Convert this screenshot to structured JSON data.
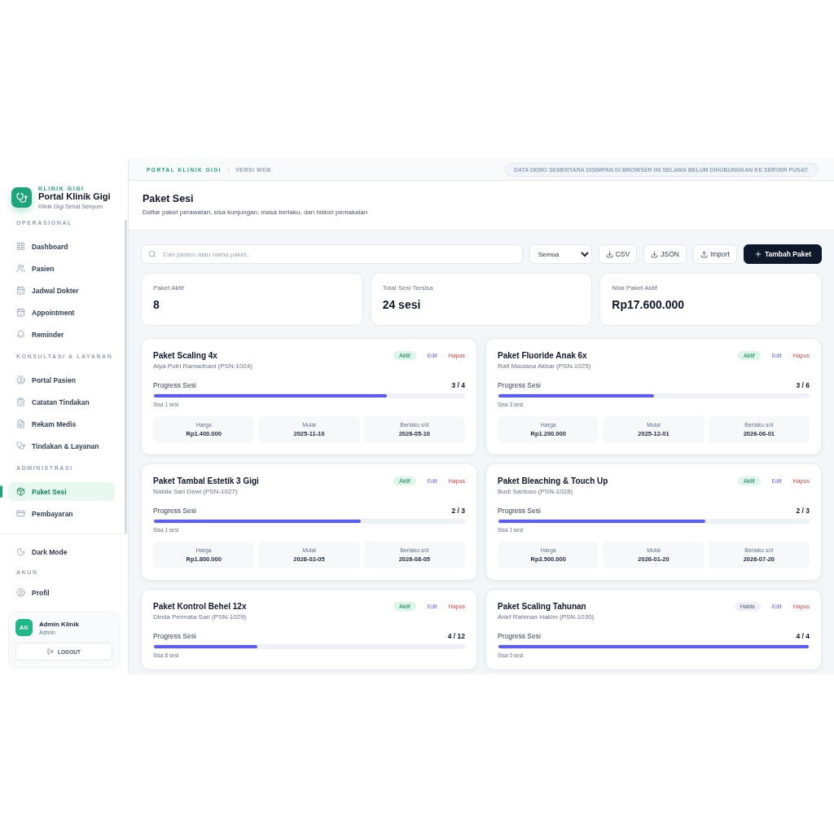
{
  "brand": {
    "eyebrow": "KLINIK GIGI",
    "title": "Portal Klinik Gigi",
    "subtitle": "Klinik Gigi Sehat Senyum"
  },
  "sidebar": {
    "sections": [
      {
        "title": "OPERASIONAL",
        "items": [
          {
            "label": "Dashboard",
            "selected": false
          },
          {
            "label": "Pasien",
            "selected": false
          },
          {
            "label": "Jadwal Dokter",
            "selected": false
          },
          {
            "label": "Appointment",
            "selected": false
          },
          {
            "label": "Reminder",
            "selected": false
          }
        ]
      },
      {
        "title": "KONSULTASI & LAYANAN",
        "items": [
          {
            "label": "Portal Pasien",
            "selected": false
          },
          {
            "label": "Catatan Tindakan",
            "selected": false
          },
          {
            "label": "Rekam Medis",
            "selected": false
          },
          {
            "label": "Tindakan & Layanan",
            "selected": false
          }
        ]
      },
      {
        "title": "ADMINISTRASI",
        "items": [
          {
            "label": "Paket Sesi",
            "selected": true
          },
          {
            "label": "Pembayaran",
            "selected": false
          }
        ]
      }
    ],
    "dark_mode": "Dark Mode",
    "account_title": "AKUN",
    "account_items": [
      {
        "label": "Profil",
        "selected": false
      }
    ],
    "user": {
      "initials": "AK",
      "name": "Admin Klinik",
      "role": "Admin",
      "logout": "LOGOUT"
    }
  },
  "topbar": {
    "brand": "PORTAL KLINIK GIGI",
    "version": "VERSI WEB",
    "notice": "DATA DEMO SEMENTARA DISIMPAN DI BROWSER INI SELAMA BELUM DIHUBUNGKAN KE SERVER PUSAT."
  },
  "header": {
    "title": "Paket Sesi",
    "subtitle": "Daftar paket perawatan, sisa kunjungan, masa berlaku, dan histori pemakaian"
  },
  "toolbar": {
    "search_placeholder": "Cari pasien atau nama paket...",
    "filter": "Semua",
    "buttons": [
      "CSV",
      "JSON",
      "Import"
    ],
    "primary": "Tambah Paket"
  },
  "stats": [
    {
      "label": "Paket Aktif",
      "value": "8"
    },
    {
      "label": "Total Sesi Tersisa",
      "value": "24 sesi"
    },
    {
      "label": "Nilai Paket Aktif",
      "value": "Rp17.600.000"
    }
  ],
  "packages": [
    {
      "name": "Paket Scaling 4x",
      "patient": "Alya Putri Ramadhani (PSN-1024)",
      "status": {
        "label": "Aktif",
        "kind": "active"
      },
      "edit": "Edit",
      "delete": "Hapus",
      "progress_label": "Progress Sesi",
      "count": "3 / 4",
      "level": 0.75,
      "remaining": "Sisa 1 sesi",
      "details": [
        {
          "label": "Harga",
          "value": "Rp1.400.000"
        },
        {
          "label": "Mulai",
          "value": "2025-11-10"
        },
        {
          "label": "Berlaku s/d",
          "value": "2026-05-10"
        }
      ]
    },
    {
      "name": "Paket Fluoride Anak 6x",
      "patient": "Rafi Maulana Akbar (PSN-1025)",
      "status": {
        "label": "Aktif",
        "kind": "active"
      },
      "edit": "Edit",
      "delete": "Hapus",
      "progress_label": "Progress Sesi",
      "count": "3 / 6",
      "level": 0.5,
      "remaining": "Sisa 3 sesi",
      "details": [
        {
          "label": "Harga",
          "value": "Rp1.200.000"
        },
        {
          "label": "Mulai",
          "value": "2025-12-01"
        },
        {
          "label": "Berlaku s/d",
          "value": "2026-06-01"
        }
      ]
    },
    {
      "name": "Paket Tambal Estetik 3 Gigi",
      "patient": "Nabila Sari Dewi (PSN-1027)",
      "status": {
        "label": "Aktif",
        "kind": "active"
      },
      "edit": "Edit",
      "delete": "Hapus",
      "progress_label": "Progress Sesi",
      "count": "2 / 3",
      "level": 0.667,
      "remaining": "Sisa 1 sesi",
      "details": [
        {
          "label": "Harga",
          "value": "Rp1.800.000"
        },
        {
          "label": "Mulai",
          "value": "2026-02-05"
        },
        {
          "label": "Berlaku s/d",
          "value": "2026-08-05"
        }
      ]
    },
    {
      "name": "Paket Bleaching & Touch Up",
      "patient": "Budi Santoso (PSN-1028)",
      "status": {
        "label": "Aktif",
        "kind": "active"
      },
      "edit": "Edit",
      "delete": "Hapus",
      "progress_label": "Progress Sesi",
      "count": "2 / 3",
      "level": 0.667,
      "remaining": "Sisa 1 sesi",
      "details": [
        {
          "label": "Harga",
          "value": "Rp3.500.000"
        },
        {
          "label": "Mulai",
          "value": "2026-01-20"
        },
        {
          "label": "Berlaku s/d",
          "value": "2026-07-20"
        }
      ]
    },
    {
      "name": "Paket Kontrol Behel 12x",
      "patient": "Dinda Permata Sari (PSN-1029)",
      "status": {
        "label": "Aktif",
        "kind": "active"
      },
      "edit": "Edit",
      "delete": "Hapus",
      "progress_label": "Progress Sesi",
      "count": "4 / 12",
      "level": 0.333,
      "remaining": "Sisa 8 sesi"
    },
    {
      "name": "Paket Scaling Tahunan",
      "patient": "Arief Rahman Hakim (PSN-1030)",
      "status": {
        "label": "Habis",
        "kind": "used_up"
      },
      "edit": "Edit",
      "delete": "Hapus",
      "progress_label": "Progress Sesi",
      "count": "4 / 4",
      "level": 1,
      "remaining": "Sisa 0 sesi"
    }
  ]
}
